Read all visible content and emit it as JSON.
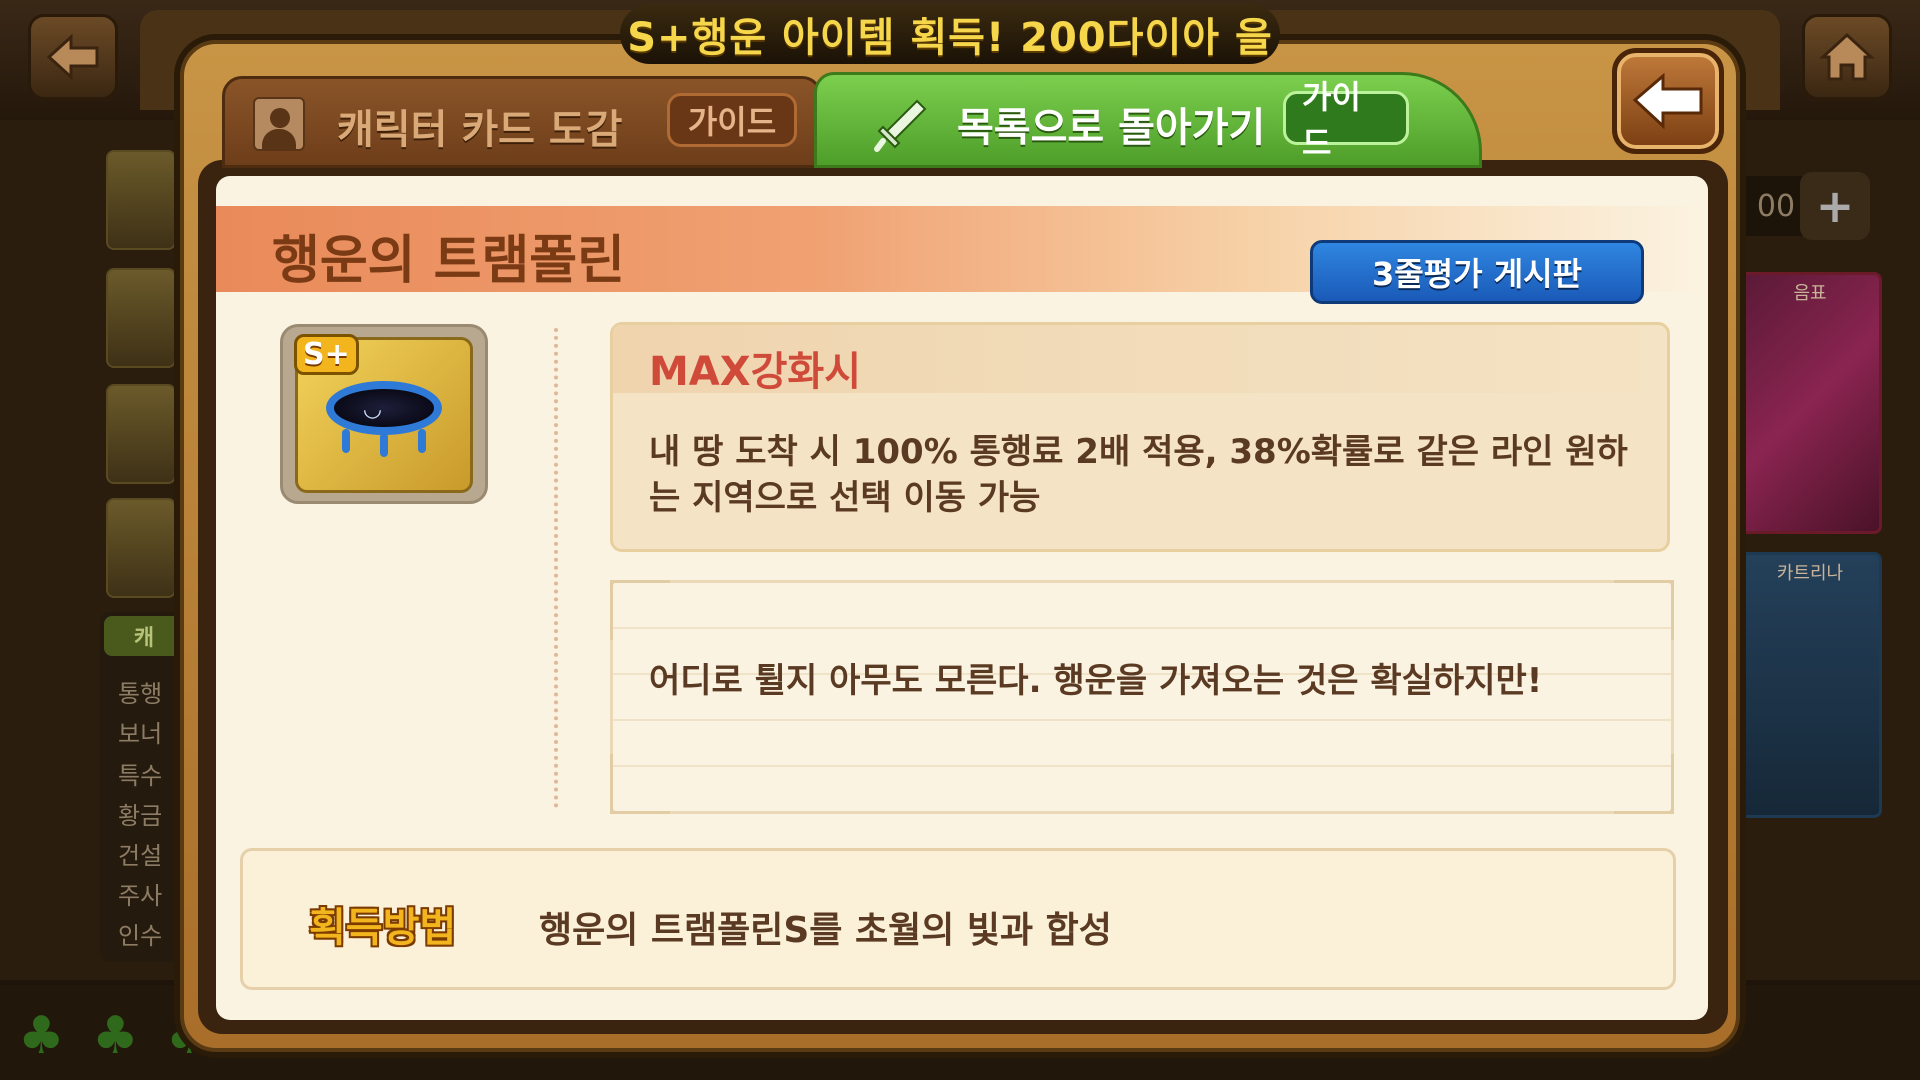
{
  "banner": {
    "text": "S+행운 아이템 획득! 200다이아 을"
  },
  "tabs": {
    "card_book_label": "캐릭터 카드 도감",
    "card_book_guide": "가이드",
    "back_to_list_label": "목록으로 돌아가기",
    "back_to_list_guide": "가이드"
  },
  "item": {
    "name": "행운의 트램폴린",
    "grade_badge": "S+",
    "board_button": "3줄평가 게시판",
    "max_title": "MAX강화시",
    "max_description": "내 땅 도착 시 100% 통행료 2배 적용, 38%확률로 같은 라인 원하는 지역으로 선택 이동 가능",
    "flavor_text": "어디로 튈지 아무도 모른다. 행운을 가져오는 것은 확실하지만!",
    "acquire_label": "획득방법",
    "acquire_text": "행운의 트램폴린S를 초월의 빛과 합성"
  },
  "background": {
    "menu_head": "캐",
    "menu_items": [
      "통행",
      "보너",
      "특수",
      "황금",
      "건설",
      "주사",
      "인수"
    ],
    "right_counter": "00",
    "right_card1_tag": "음표",
    "right_card2_tag": "카트리나"
  },
  "icons": {
    "back": "back-arrow-icon",
    "home": "home-icon",
    "close": "return-arrow-icon",
    "character": "character-silhouette-icon",
    "sword": "sword-icon"
  },
  "colors": {
    "tab_active": "#5fb43a",
    "title_band": "#e98a5a",
    "board_button": "#2f86e0",
    "max_title": "#d04a3a"
  }
}
